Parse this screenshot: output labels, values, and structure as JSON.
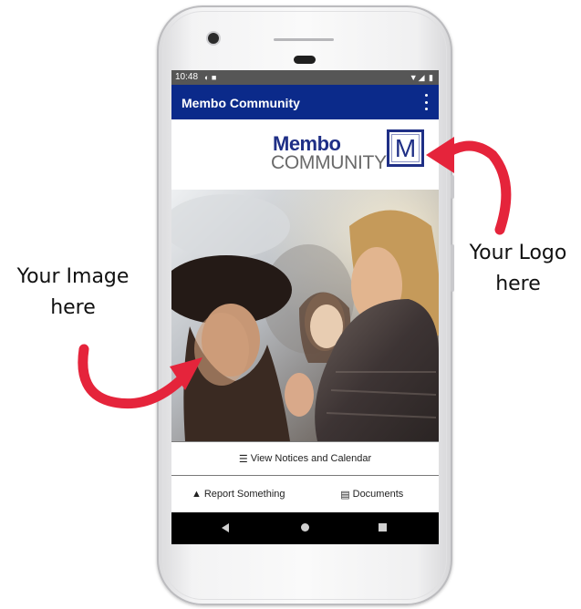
{
  "status_bar": {
    "time": "10:48",
    "left_icons": "◐ ■",
    "right_icons": "▼◢ ▮"
  },
  "app_bar": {
    "title": "Membo Community"
  },
  "logo": {
    "line1": "Membo",
    "line2": "COMMUNITY",
    "mark": "M"
  },
  "buttons": {
    "notices": {
      "icon": "☰",
      "label": "View Notices and Calendar"
    },
    "report": {
      "icon": "▲",
      "label": "Report Something"
    },
    "documents": {
      "icon": "▤",
      "label": "Documents"
    }
  },
  "annotations": {
    "image_line1": "Your Image",
    "image_line2": "here",
    "logo_line1": "Your Logo",
    "logo_line2": "here"
  },
  "colors": {
    "app_bar": "#0b2a8a",
    "logo_blue": "#1f2f86",
    "arrow_red": "#e5243b"
  }
}
